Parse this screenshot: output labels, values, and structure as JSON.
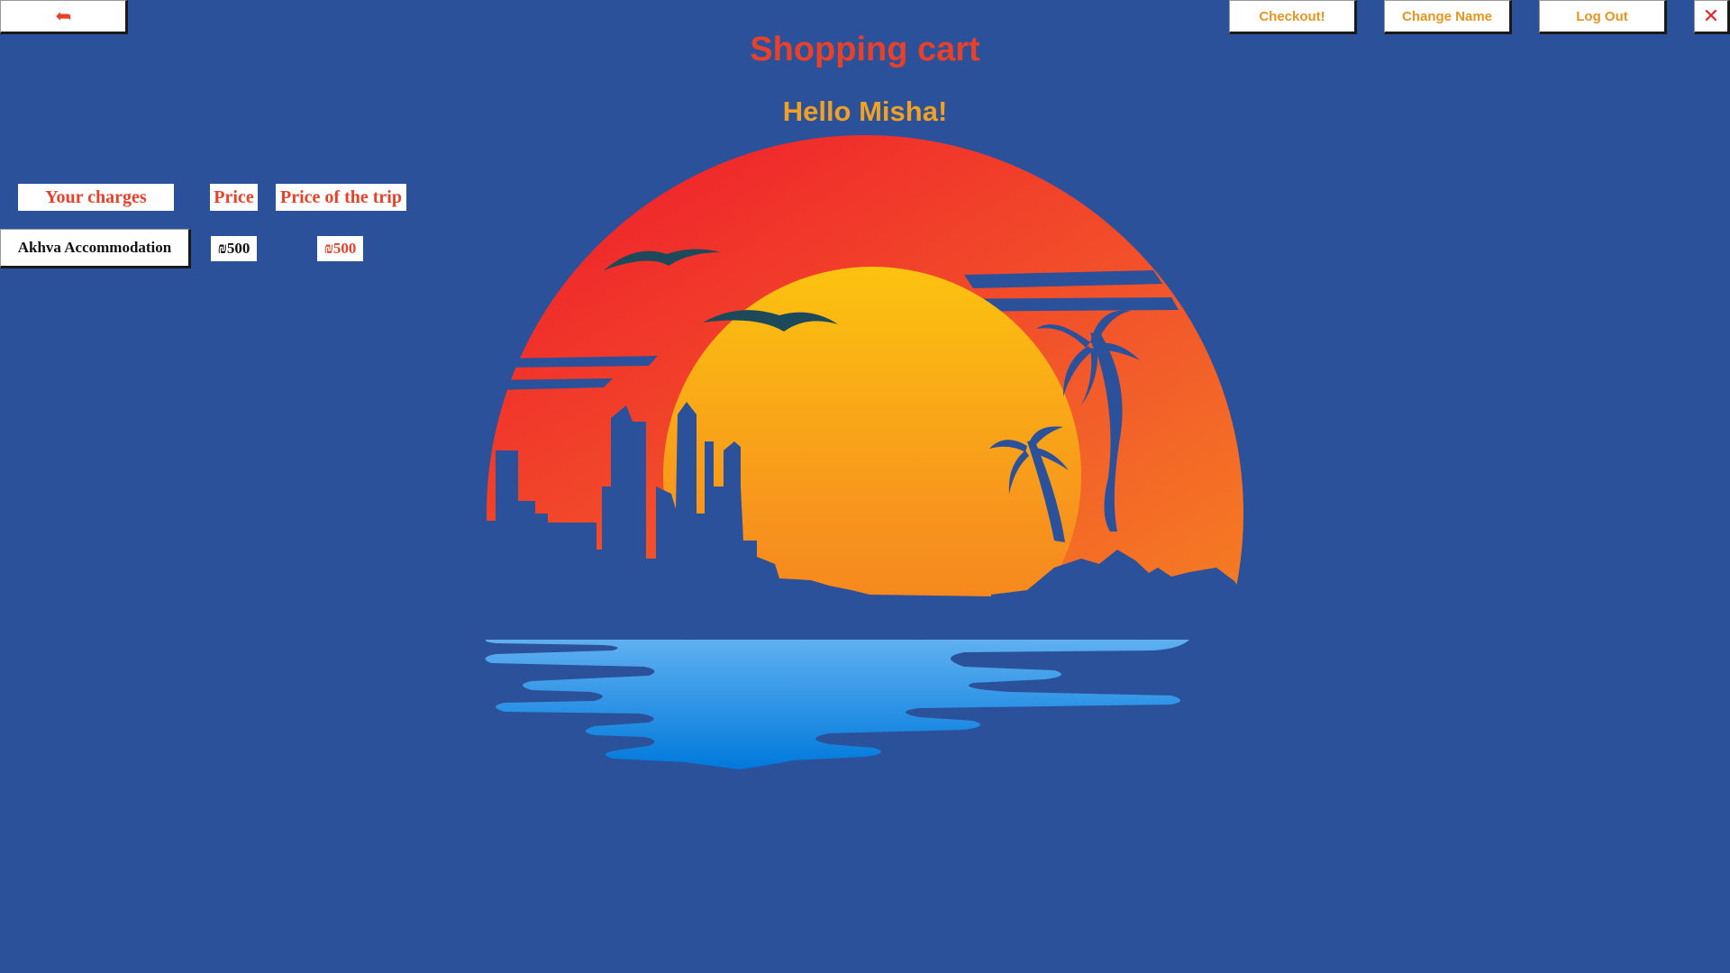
{
  "header": {
    "back_icon": "back-arrow-icon",
    "back_glyph": "➦",
    "checkout_label": "Checkout!",
    "change_name_label": "Change Name",
    "logout_label": "Log Out",
    "close_icon": "close-x-icon",
    "close_glyph": "✕"
  },
  "title": "Shopping cart",
  "greeting": "Hello Misha!",
  "cart": {
    "columns": [
      "Your charges",
      "Price",
      "Price of the trip"
    ],
    "rows": [
      {
        "item": "Akhva Accommodation",
        "price": "₪500",
        "trip_price": "₪500"
      }
    ]
  },
  "colors": {
    "background": "#2b519b",
    "title": "#e8412a",
    "greeting": "#f0a023",
    "button_text": "#e8941f",
    "close": "#e8232a"
  },
  "illustration": {
    "subject": "sunset-city-beach-illustration"
  }
}
